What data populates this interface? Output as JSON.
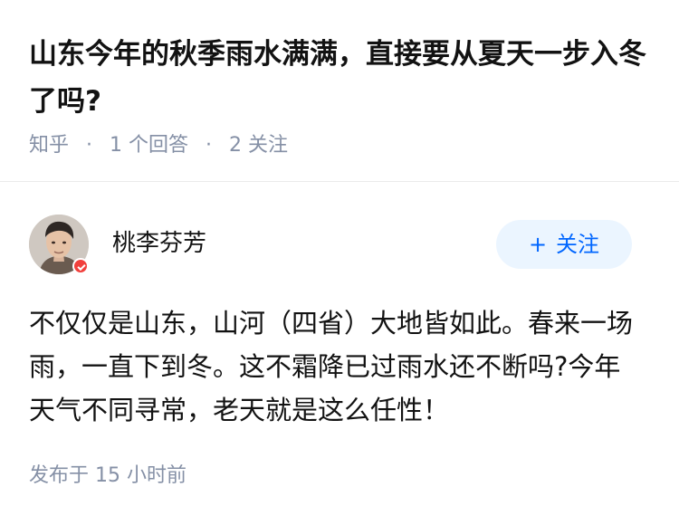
{
  "question": {
    "title": "山东今年的秋季雨水满满，直接要从夏天一步入冬了吗?",
    "meta": {
      "source": "知乎",
      "separator": "·",
      "answers": "1 个回答",
      "followers": "2 关注"
    }
  },
  "answer": {
    "author": {
      "name": "桃李芬芳",
      "avatar_icon": "person-avatar",
      "badge_icon": "verified-badge-icon"
    },
    "follow_button": {
      "plus": "+",
      "label": "关注",
      "color": "#0066ff",
      "background": "#ebf5ff"
    },
    "content": "不仅仅是山东，山河（四省）大地皆如此。春来一场雨，一直下到冬。这不霜降已过雨水还不断吗?今年天气不同寻常，老天就是这么任性！",
    "published": "发布于 15 小时前"
  }
}
